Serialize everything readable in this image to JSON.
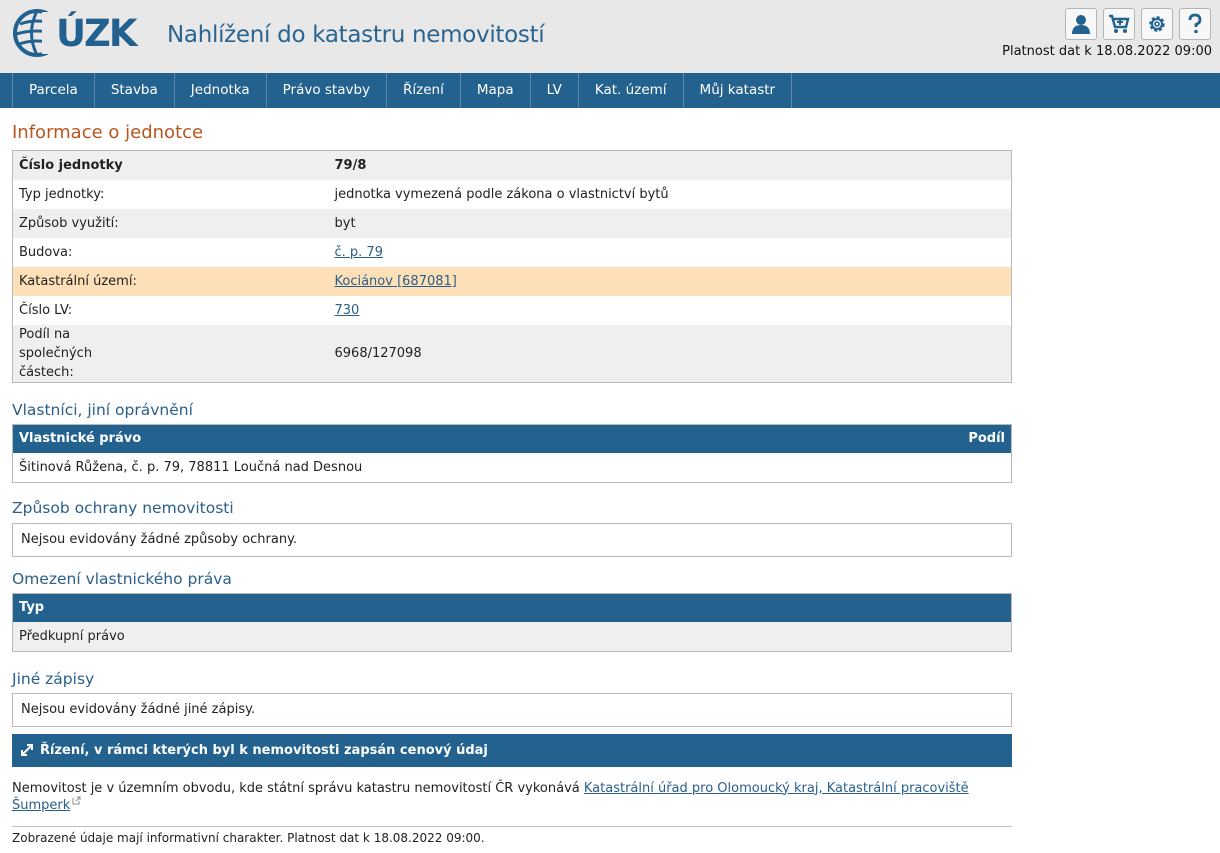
{
  "header": {
    "logo_text": "ÚZK",
    "app_title": "Nahlížení do katastru nemovitostí",
    "validity": "Platnost dat k 18.08.2022 09:00",
    "icons": [
      "user-icon",
      "cart-icon",
      "gear-icon",
      "help-icon"
    ]
  },
  "nav": {
    "items": [
      "Parcela",
      "Stavba",
      "Jednotka",
      "Právo stavby",
      "Řízení",
      "Mapa",
      "LV",
      "Kat. území",
      "Můj katastr"
    ]
  },
  "info": {
    "title": "Informace o jednotce",
    "rows": [
      {
        "label": "Číslo jednotky",
        "value": "79/8"
      },
      {
        "label": "Typ jednotky:",
        "value": "jednotka vymezená podle zákona o vlastnictví bytů"
      },
      {
        "label": "Způsob využití:",
        "value": "byt"
      },
      {
        "label": "Budova:",
        "value": "č. p. 79"
      },
      {
        "label": "Katastrální území:",
        "value": "Kociánov [687081]"
      },
      {
        "label": "Číslo LV:",
        "value": "730"
      },
      {
        "label": "Podíl na společných částech:",
        "value": "6968/127098"
      }
    ]
  },
  "owners": {
    "title": "Vlastníci, jiní oprávnění",
    "col_owner": "Vlastnické právo",
    "col_share": "Podíl",
    "rows": [
      {
        "name": "Šitinová Růžena, č. p. 79, 78811 Loučná nad Desnou",
        "share": ""
      }
    ]
  },
  "protection": {
    "title": "Způsob ochrany nemovitosti",
    "text": "Nejsou evidovány žádné způsoby ochrany."
  },
  "restriction": {
    "title": "Omezení vlastnického práva",
    "col_type": "Typ",
    "rows": [
      "Předkupní právo"
    ]
  },
  "other": {
    "title": "Jiné zápisy",
    "text": "Nejsou evidovány žádné jiné zápisy."
  },
  "proceedings_bar": "Řízení, v rámci kterých byl k nemovitosti zapsán cenový údaj",
  "note": {
    "text": "Nemovitost je v územním obvodu, kde státní správu katastru nemovitostí ČR vykonává ",
    "link": "Katastrální úřad pro Olomoucký kraj, Katastrální pracoviště Šumperk"
  },
  "footer": "Zobrazené údaje mají informativní charakter. Platnost dat k 18.08.2022 09:00.",
  "colors": {
    "brand": "#23628f",
    "title_orange": "#b9541c",
    "highlight": "#fde0b8"
  }
}
